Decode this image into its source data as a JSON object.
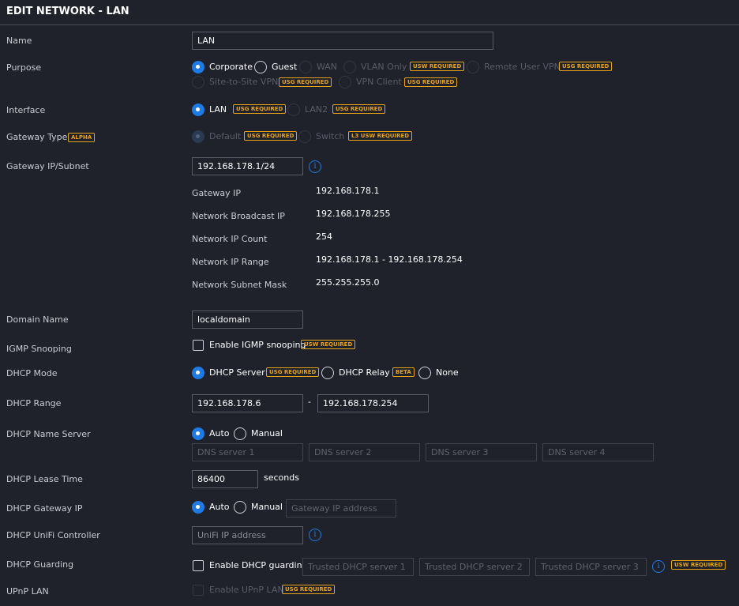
{
  "title": "EDIT NETWORK - LAN",
  "name": {
    "label": "Name",
    "value": "LAN"
  },
  "purpose": {
    "label": "Purpose",
    "corporate": "Corporate",
    "guest": "Guest",
    "wan": "WAN",
    "vlan_only": "VLAN Only",
    "vlan_badge": "USW REQUIRED",
    "remote_vpn": "Remote User VPN",
    "remote_badge": "USG REQUIRED",
    "site_vpn": "Site-to-Site VPN",
    "site_badge": "USG REQUIRED",
    "vpn_client": "VPN Client",
    "vpn_client_badge": "USG REQUIRED"
  },
  "interface": {
    "label": "Interface",
    "lan": "LAN",
    "lan_badge": "USG REQUIRED",
    "lan2": "LAN2",
    "lan2_badge": "USG REQUIRED"
  },
  "gateway_type": {
    "label": "Gateway Type",
    "badge": "ALPHA",
    "default": "Default",
    "default_badge": "USG REQUIRED",
    "switch": "Switch",
    "switch_badge": "L3 USW REQUIRED"
  },
  "gateway_ip": {
    "label": "Gateway IP/Subnet",
    "value": "192.168.178.1/24"
  },
  "subnet_info": [
    {
      "label": "Gateway IP",
      "value": "192.168.178.1"
    },
    {
      "label": "Network Broadcast IP",
      "value": "192.168.178.255"
    },
    {
      "label": "Network IP Count",
      "value": "254"
    },
    {
      "label": "Network IP Range",
      "value": "192.168.178.1 - 192.168.178.254"
    },
    {
      "label": "Network Subnet Mask",
      "value": "255.255.255.0"
    }
  ],
  "domain": {
    "label": "Domain Name",
    "value": "localdomain"
  },
  "igmp": {
    "label": "IGMP Snooping",
    "check": "Enable IGMP snooping",
    "badge": "USW REQUIRED"
  },
  "dhcp_mode": {
    "label": "DHCP Mode",
    "server": "DHCP Server",
    "server_badge": "USG REQUIRED",
    "relay": "DHCP Relay",
    "relay_badge": "BETA",
    "none": "None"
  },
  "dhcp_range": {
    "label": "DHCP Range",
    "start": "192.168.178.6",
    "sep": "-",
    "end": "192.168.178.254"
  },
  "dhcp_ns": {
    "label": "DHCP Name Server",
    "auto": "Auto",
    "manual": "Manual",
    "dns1": "DNS server 1",
    "dns2": "DNS server 2",
    "dns3": "DNS server 3",
    "dns4": "DNS server 4"
  },
  "lease": {
    "label": "DHCP Lease Time",
    "value": "86400",
    "unit": "seconds"
  },
  "dhcp_gw": {
    "label": "DHCP Gateway IP",
    "auto": "Auto",
    "manual": "Manual",
    "placeholder": "Gateway IP address"
  },
  "unifi": {
    "label": "DHCP UniFi Controller",
    "placeholder": "UniFi IP address"
  },
  "guard": {
    "label": "DHCP Guarding",
    "check": "Enable DHCP guarding",
    "s1": "Trusted DHCP server 1",
    "s2": "Trusted DHCP server 2",
    "s3": "Trusted DHCP server 3",
    "badge": "USW REQUIRED"
  },
  "upnp": {
    "label": "UPnP LAN",
    "check": "Enable UPnP LAN",
    "badge": "USG REQUIRED"
  }
}
